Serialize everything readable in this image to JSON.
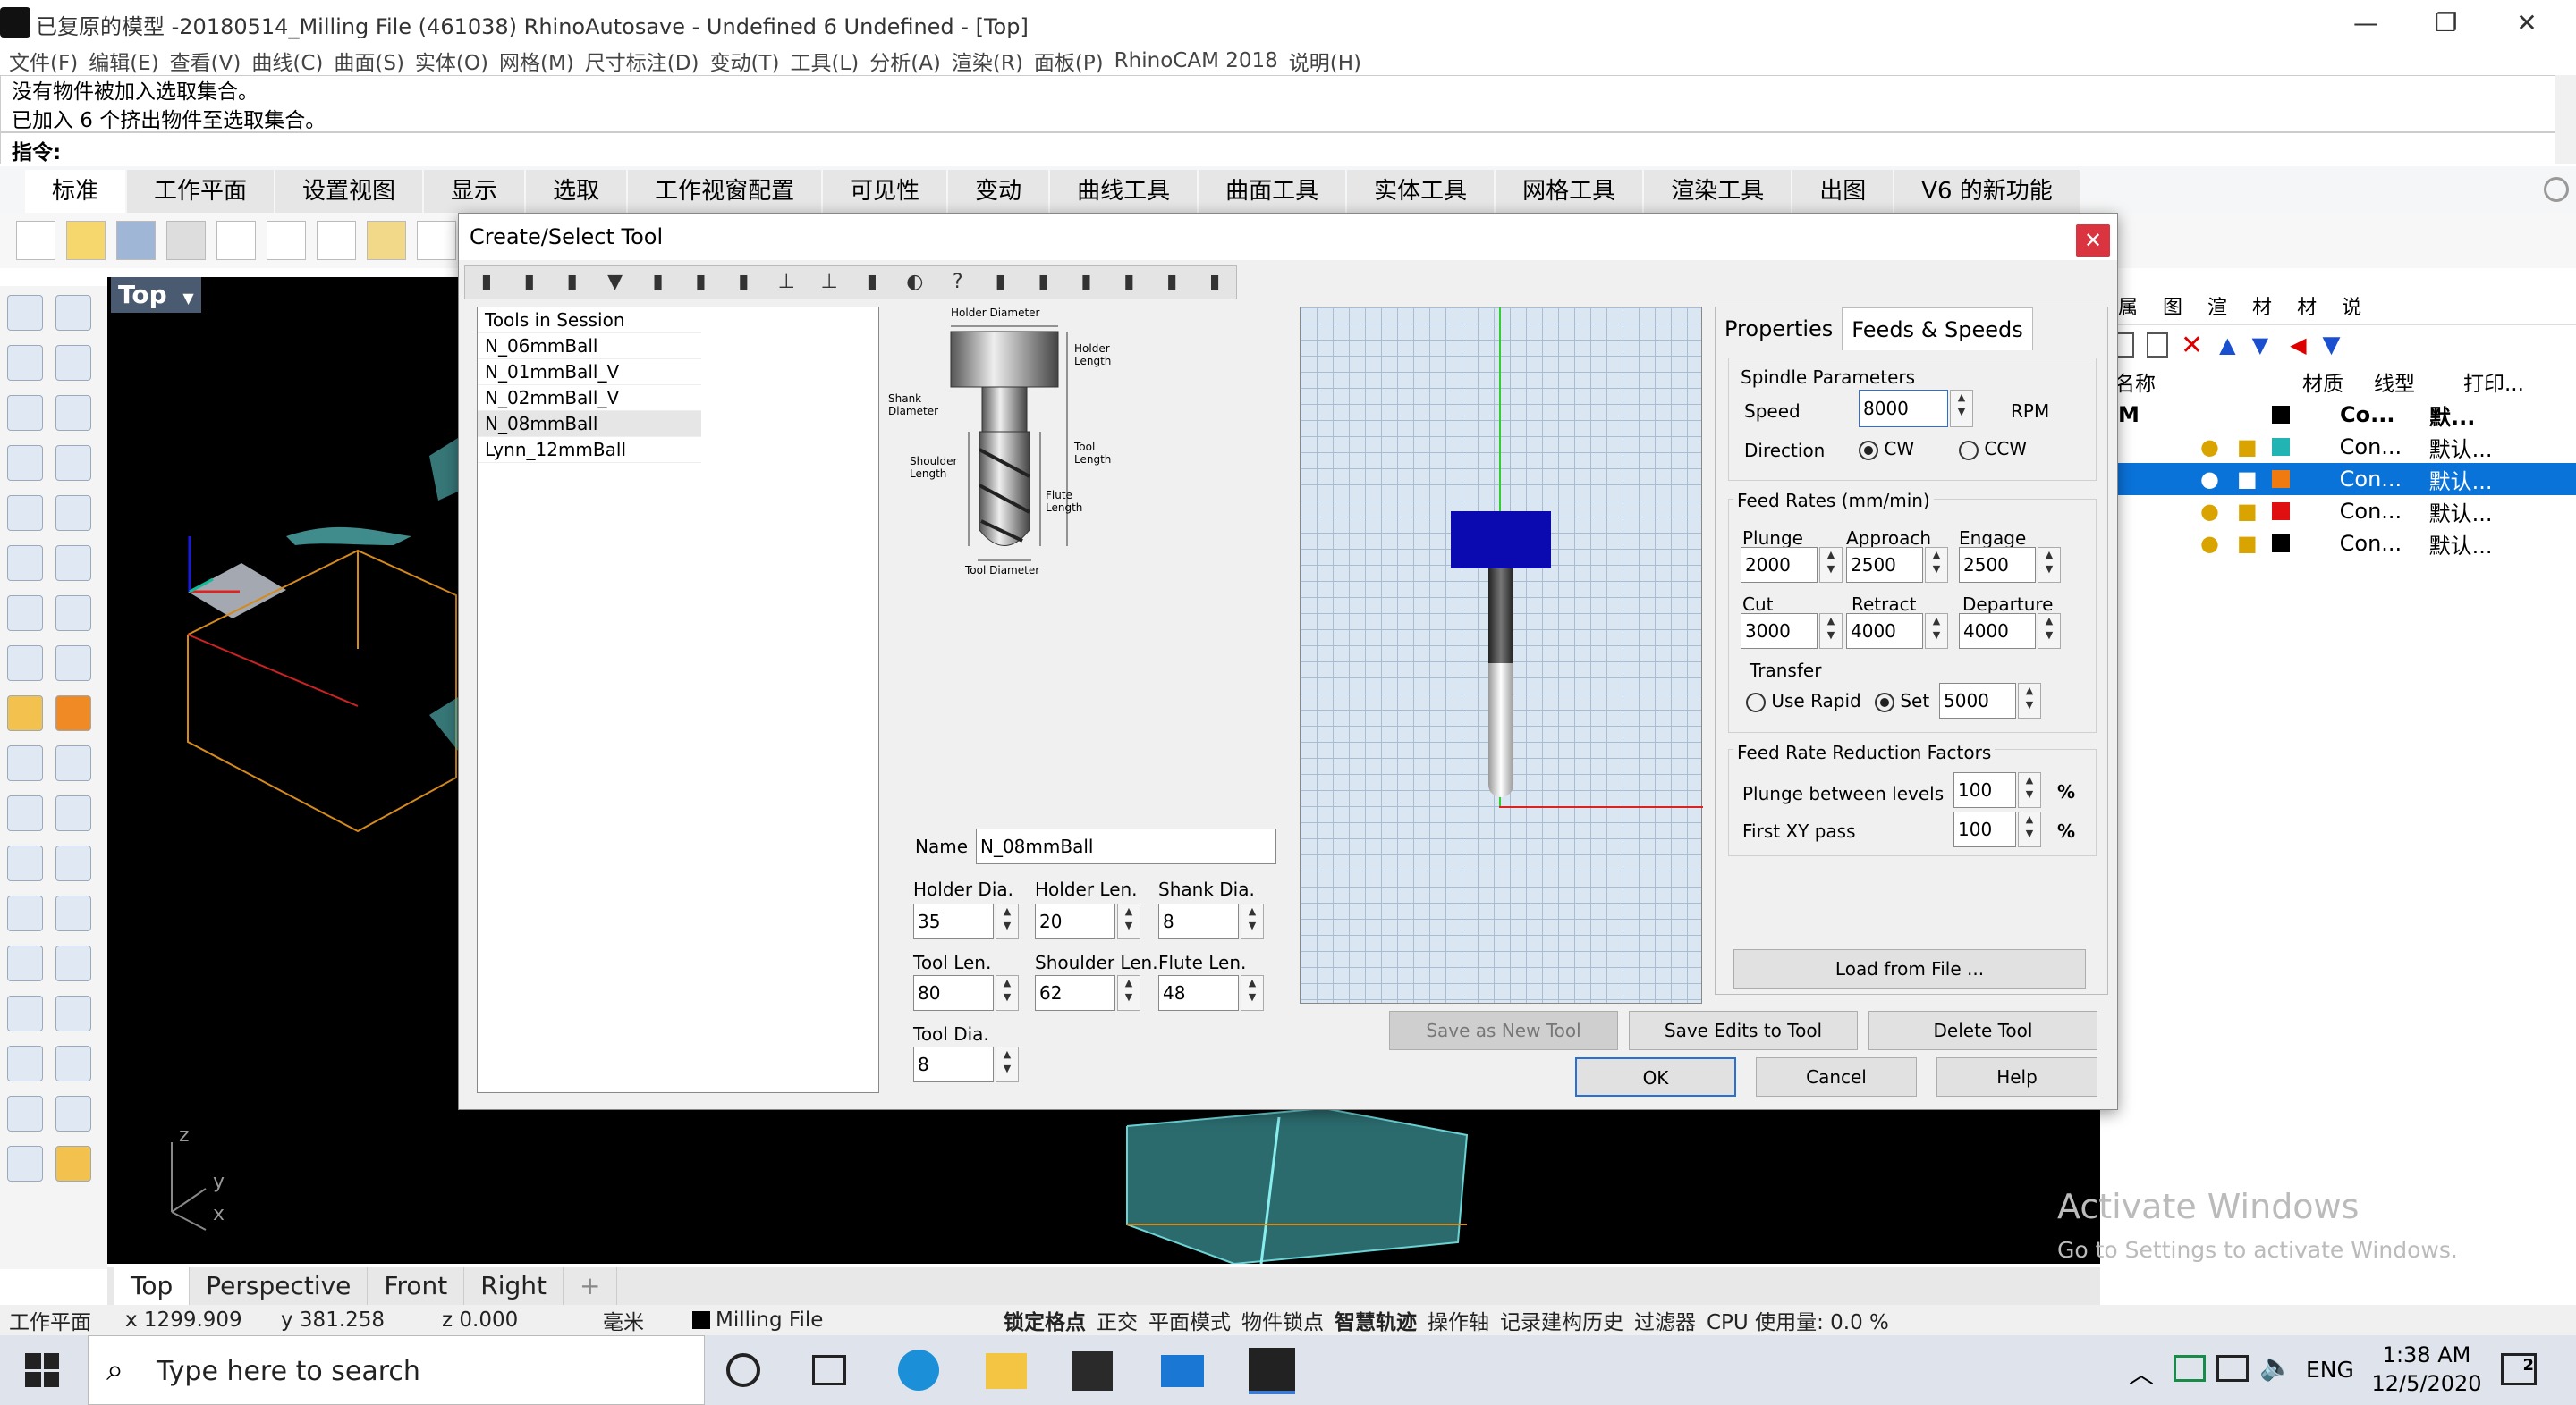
{
  "window": {
    "title": "已复原的模型 -20180514_Milling File (461038) RhinoAutosave - Undefined 6 Undefined - [Top]",
    "minimize": "—",
    "restore": "❐",
    "close": "✕"
  },
  "menu": [
    "文件(F)",
    "编辑(E)",
    "查看(V)",
    "曲线(C)",
    "曲面(S)",
    "实体(O)",
    "网格(M)",
    "尺寸标注(D)",
    "变动(T)",
    "工具(L)",
    "分析(A)",
    "渲染(R)",
    "面板(P)",
    "RhinoCAM 2018",
    "说明(H)"
  ],
  "command_history": [
    "没有物件被加入选取集合。",
    "已加入 6 个挤出物件至选取集合。"
  ],
  "command_prompt": "指令:",
  "ribbon_tabs": [
    "标准",
    "工作平面",
    "设置视图",
    "显示",
    "选取",
    "工作视窗配置",
    "可见性",
    "变动",
    "曲线工具",
    "曲面工具",
    "实体工具",
    "网格工具",
    "渲染工具",
    "出图",
    "V6 的新功能"
  ],
  "viewport": {
    "label": "Top",
    "axis_y": "y",
    "axis_x": "x",
    "axis_z": "z"
  },
  "viewport_tabs": [
    "Top",
    "Perspective",
    "Front",
    "Right",
    "+"
  ],
  "status": {
    "cplane": "工作平面",
    "x": "x 1299.909",
    "y": "y 381.258",
    "z": "z 0.000",
    "units": "毫米",
    "layer": "Milling File",
    "toggles": [
      "锁定格点",
      "正交",
      "平面模式",
      "物件锁点",
      "智慧轨迹",
      "操作轴",
      "记录建构历史",
      "过滤器"
    ],
    "cpu": "CPU 使用量: 0.0 %"
  },
  "taskbar": {
    "search_placeholder": "Type here to search",
    "lang": "ENG",
    "time": "1:38 AM",
    "date": "12/5/2020",
    "notif_count": "2"
  },
  "watermark": {
    "line1": "Activate Windows",
    "line2": "Go to Settings to activate Windows."
  },
  "right_panel": {
    "tabs": [
      "属",
      "图",
      "渲",
      "材",
      "材",
      "说"
    ],
    "columns": [
      "名称",
      "材质",
      "线型",
      "打印..."
    ],
    "layers": [
      {
        "name": "M",
        "mat": "Co...",
        "print": "默...",
        "color": "#000000",
        "selected": false
      },
      {
        "name": "",
        "mat": "Con...",
        "print": "默认...",
        "color": "#22b3b3",
        "selected": false
      },
      {
        "name": "",
        "mat": "Con...",
        "print": "默认...",
        "color": "#f07a10",
        "selected": true
      },
      {
        "name": "",
        "mat": "Con...",
        "print": "默认...",
        "color": "#e01010",
        "selected": false
      },
      {
        "name": "",
        "mat": "Con...",
        "print": "默认...",
        "color": "#000000",
        "selected": false
      }
    ]
  },
  "dialog": {
    "title": "Create/Select Tool",
    "close": "✕",
    "tool_list_header": "Tools in Session",
    "tools": [
      "N_06mmBall",
      "N_01mmBall_V",
      "N_02mmBall_V",
      "N_08mmBall",
      "Lynn_12mmBall"
    ],
    "selected_tool": "N_08mmBall",
    "diagram_labels": {
      "holder_diameter": "Holder Diameter",
      "holder_length": "Holder Length",
      "shank_diameter": "Shank Diameter",
      "tool_length": "Tool Length",
      "shoulder_length": "Shoulder Length",
      "flute_length": "Flute Length",
      "tool_diameter": "Tool Diameter"
    },
    "name_label": "Name",
    "name_value": "N_08mmBall",
    "dims": {
      "holder_dia_label": "Holder Dia.",
      "holder_dia": "35",
      "holder_len_label": "Holder Len.",
      "holder_len": "20",
      "shank_dia_label": "Shank Dia.",
      "shank_dia": "8",
      "tool_len_label": "Tool Len.",
      "tool_len": "80",
      "shoulder_len_label": "Shoulder Len.",
      "shoulder_len": "62",
      "flute_len_label": "Flute Len.",
      "flute_len": "48",
      "tool_dia_label": "Tool Dia.",
      "tool_dia": "8"
    },
    "tabs": [
      "Properties",
      "Feeds & Speeds"
    ],
    "spindle": {
      "title": "Spindle Parameters",
      "speed_label": "Speed",
      "speed": "8000",
      "rpm": "RPM",
      "direction_label": "Direction",
      "cw": "CW",
      "ccw": "CCW"
    },
    "feeds": {
      "title": "Feed Rates (mm/min)",
      "plunge_label": "Plunge",
      "plunge": "2000",
      "approach_label": "Approach",
      "approach": "2500",
      "engage_label": "Engage",
      "engage": "2500",
      "cut_label": "Cut",
      "cut": "3000",
      "retract_label": "Retract",
      "retract": "4000",
      "departure_label": "Departure",
      "departure": "4000",
      "transfer_label": "Transfer",
      "use_rapid": "Use Rapid",
      "set": "Set",
      "set_value": "5000"
    },
    "reduction": {
      "title": "Feed Rate Reduction Factors",
      "plunge_label": "Plunge between levels",
      "plunge": "100",
      "first_xy_label": "First XY pass",
      "first_xy": "100",
      "pct": "%"
    },
    "buttons": {
      "load": "Load from File ...",
      "save_new": "Save as New Tool",
      "save_edits": "Save Edits to Tool",
      "delete": "Delete Tool",
      "ok": "OK",
      "cancel": "Cancel",
      "help": "Help"
    }
  }
}
